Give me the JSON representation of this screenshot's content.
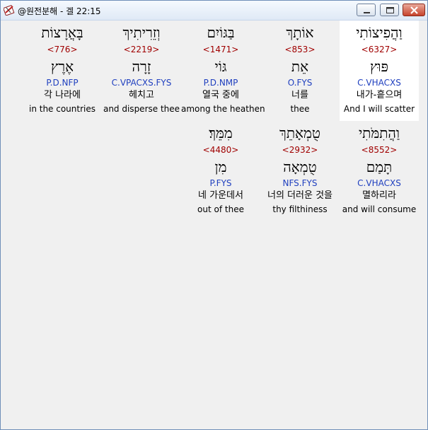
{
  "window": {
    "title": "@원전분해 - 겔 22:15",
    "controls": {
      "minimize": "minimize",
      "maximize": "maximize",
      "close": "close"
    }
  },
  "rows": [
    {
      "words": [
        {
          "hebrew": "וַהֲפִיצוֹתִי",
          "strong": "<6327>",
          "lemma": "פּוּץ",
          "morph": "C.VHACXS",
          "korean": "내가-흩으며",
          "english": "And I will scatter",
          "highlighted": true
        },
        {
          "hebrew": "אוֹתָךְ",
          "strong": "<853>",
          "lemma": "אֵת",
          "morph": "O.FYS",
          "korean": "너를",
          "english": "thee",
          "highlighted": false
        },
        {
          "hebrew": "בַּגּוֹיִם",
          "strong": "<1471>",
          "lemma": "גּוֹי",
          "morph": "P.D.NMP",
          "korean": "열국 중에",
          "english": "among the heathen",
          "highlighted": false
        },
        {
          "hebrew": "וְזֵרִיתִיךְ",
          "strong": "<2219>",
          "lemma": "זָרָה",
          "morph": "C.VPACXS.FYS",
          "korean": "헤치고",
          "english": "and disperse thee",
          "highlighted": false
        },
        {
          "hebrew": "בָּאֲרָצוֹת",
          "strong": "<776>",
          "lemma": "אֶרֶץ",
          "morph": "P.D.NFP",
          "korean": "각 나라에",
          "english": "in the countries",
          "highlighted": false
        }
      ]
    },
    {
      "words": [
        {
          "hebrew": "וַהֲתִמֹּתִי",
          "strong": "<8552>",
          "lemma": "תָּמַם",
          "morph": "C.VHACXS",
          "korean": "멸하리라",
          "english": "and will consume",
          "highlighted": false
        },
        {
          "hebrew": "טֻמְאָתֵךְ",
          "strong": "<2932>",
          "lemma": "טֻמְאָה",
          "morph": "NFS.FYS",
          "korean": "너의 더러운 것을",
          "english": "thy filthiness",
          "highlighted": false
        },
        {
          "hebrew": "מִמֵּךְ׃",
          "strong": "<4480>",
          "lemma": "מִן",
          "morph": "P.FYS",
          "korean": "네 가운데서",
          "english": "out of thee",
          "highlighted": false
        }
      ]
    }
  ],
  "colors": {
    "strong": "#a00000",
    "morph": "#1f3fbf",
    "highlight": "#ffffff",
    "background": "#f0f0f0"
  },
  "icons": {
    "app": "bible-icon"
  }
}
